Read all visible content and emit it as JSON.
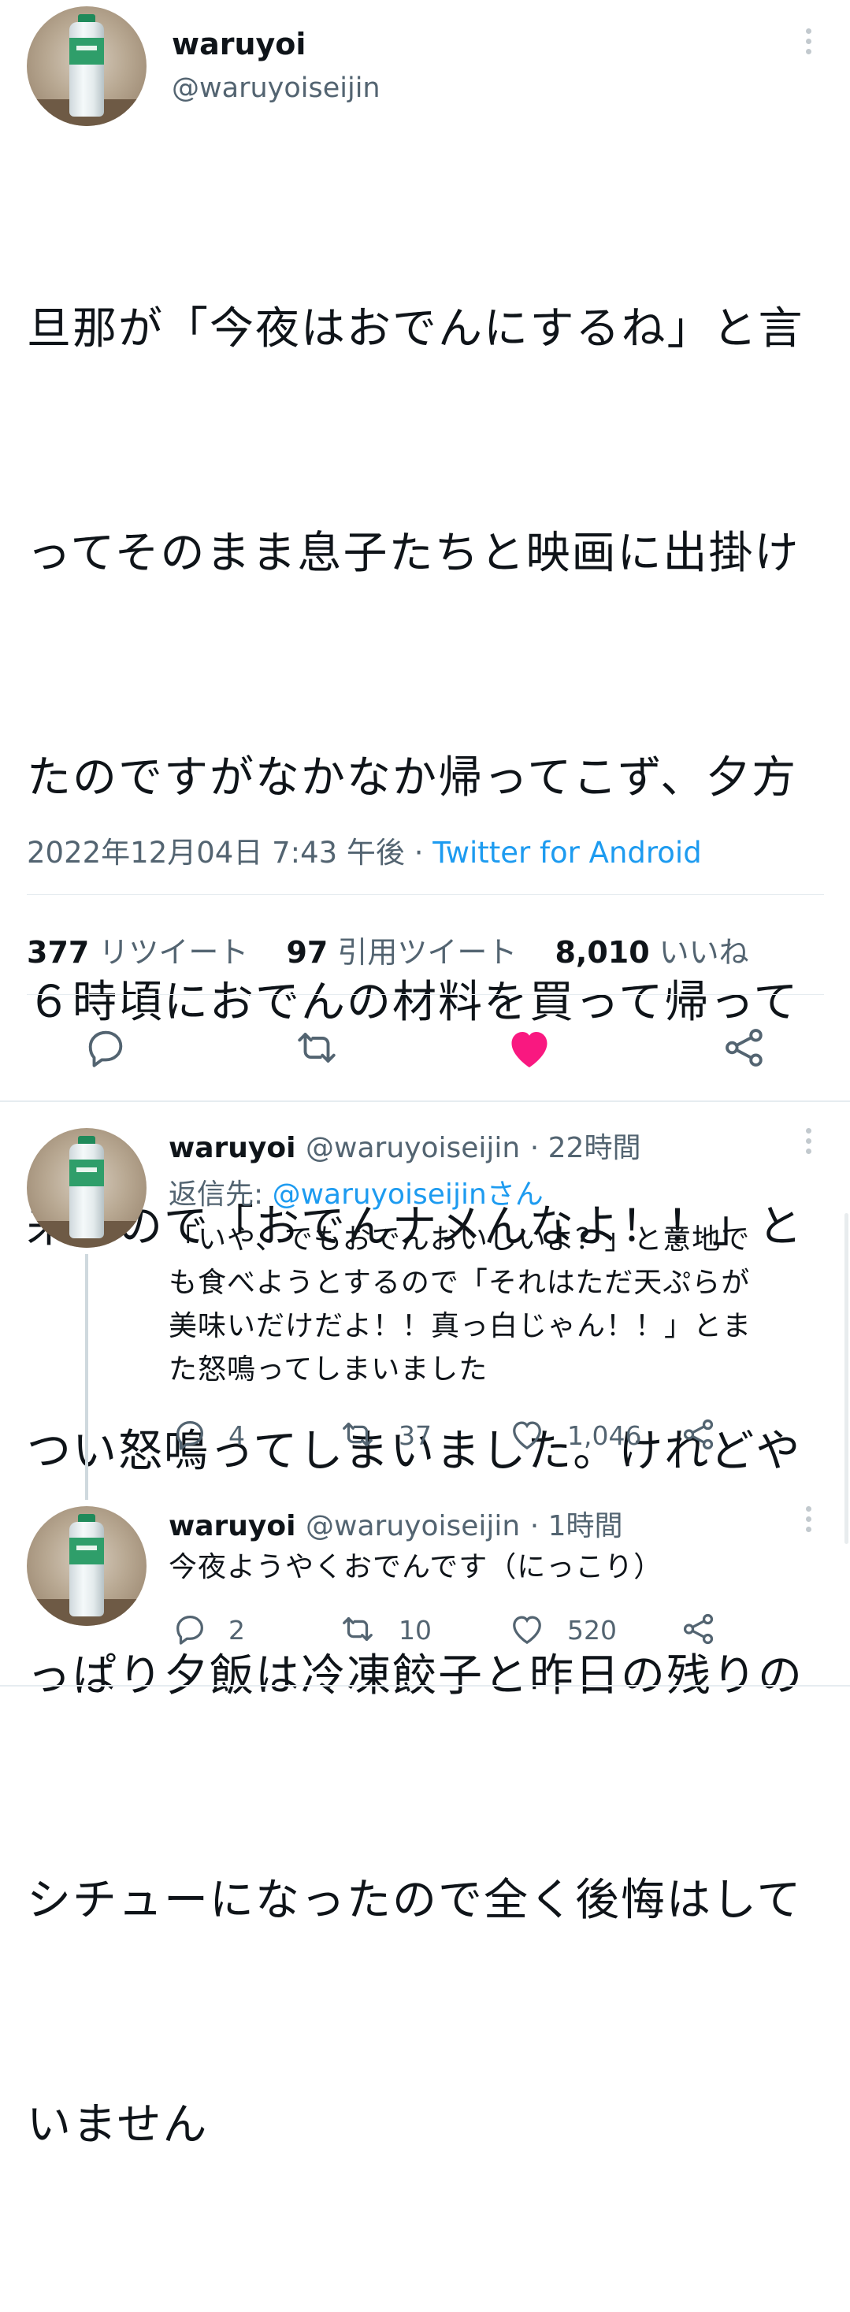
{
  "main": {
    "name": "waruyoi",
    "handle": "@waruyoiseijin",
    "text": "旦那が「今夜はおでんにするね」と言ってそのまま息子たちと映画に出掛けたのですがなかなか帰ってこず、夕方６時頃におでんの材料を買って帰って来たので「おでんナメんなよ！！」とつい怒鳴ってしまいました。けれどやっぱり夕飯は冷凍餃子と昨日の残りのシチューになったので全く後悔はしていません",
    "lines": [
      "旦那が「今夜はおでんにするね」と言",
      "ってそのまま息子たちと映画に出掛け",
      "たのですがなかなか帰ってこず、夕方",
      "６時頃におでんの材料を買って帰って",
      "来たので「おでんナメんなよ！！」と",
      "つい怒鳴ってしまいました。けれどや",
      "っぱり夕飯は冷凍餃子と昨日の残りの",
      "シチューになったので全く後悔はして",
      "いません"
    ],
    "timestamp": "2022年12月04日 7:43 午後",
    "separator": " · ",
    "source": "Twitter for Android",
    "retweets_count": "377",
    "retweets_label": "リツイート",
    "quotes_count": "97",
    "quotes_label": "引用ツイート",
    "likes_count": "8,010",
    "likes_label": "いいね",
    "liked": true
  },
  "replies": [
    {
      "name": "waruyoi",
      "handle": "@waruyoiseijin",
      "time": "· 22時間",
      "reply_to_prefix": "返信先: ",
      "reply_to_link": "@waruyoiseijinさん",
      "lines": [
        "「いや、でもおでんおいしいよ？」と意地で",
        "も食べようとするので「それはただ天ぷらが",
        "美味いだけだよ！！真っ白じゃん！！」とま",
        "た怒鳴ってしまいました"
      ],
      "replies": "4",
      "retweets": "37",
      "likes": "1,046"
    },
    {
      "name": "waruyoi",
      "handle": "@waruyoiseijin",
      "time": "· 1時間",
      "lines": [
        "今夜ようやくおでんです（にっこり）"
      ],
      "replies": "2",
      "retweets": "10",
      "likes": "520"
    }
  ],
  "colors": {
    "accent": "#1d9bf0",
    "like": "#f91880",
    "muted": "#536471",
    "text": "#0f1419"
  },
  "icons": [
    "more-vertical-icon",
    "reply-icon",
    "retweet-icon",
    "heart-icon",
    "share-icon"
  ]
}
